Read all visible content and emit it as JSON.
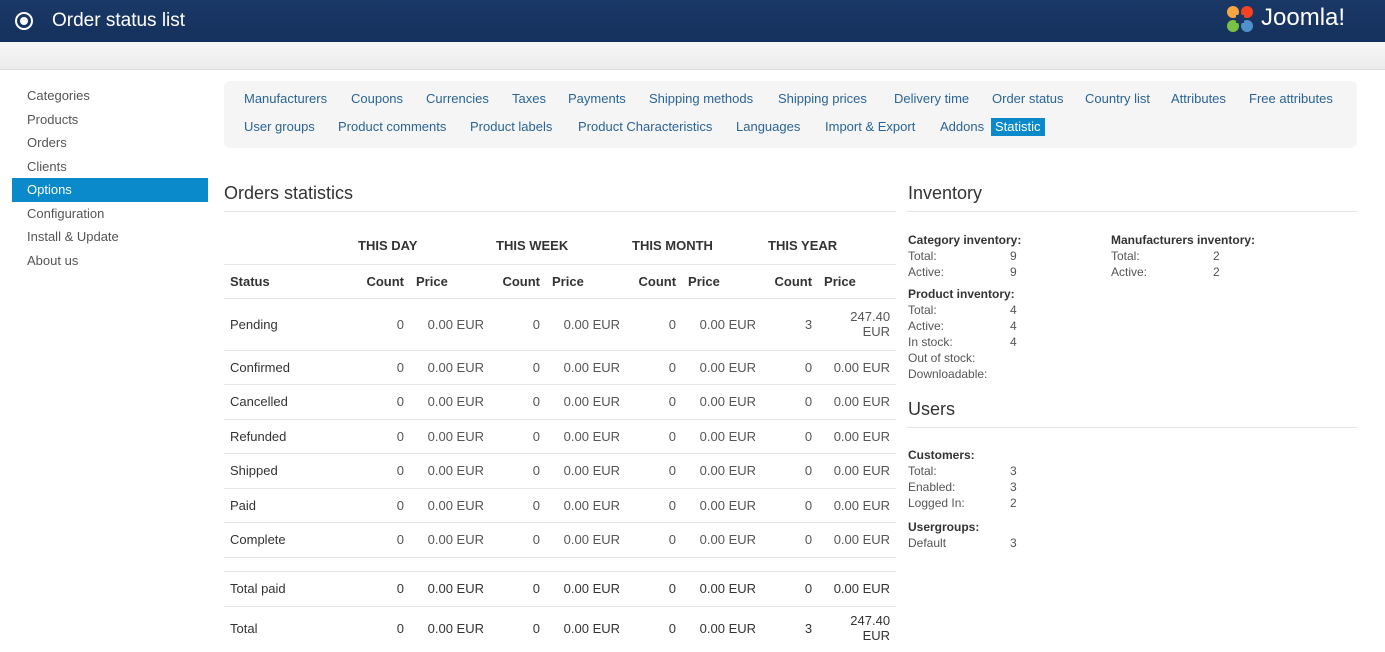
{
  "header": {
    "title": "Order status list",
    "brand": "Joomla!"
  },
  "sidebar": {
    "items": [
      {
        "label": "Categories",
        "active": false
      },
      {
        "label": "Products",
        "active": false
      },
      {
        "label": "Orders",
        "active": false
      },
      {
        "label": "Clients",
        "active": false
      },
      {
        "label": "Options",
        "active": true
      },
      {
        "label": "Configuration",
        "active": false
      },
      {
        "label": "Install & Update",
        "active": false
      },
      {
        "label": "About us",
        "active": false
      }
    ]
  },
  "submenu": {
    "row1": [
      "Manufacturers",
      "Coupons",
      "Currencies",
      "Taxes",
      "Payments",
      "Shipping methods",
      "Shipping prices",
      "Delivery time",
      "Order status",
      "Country list",
      "Attributes",
      "Free attributes"
    ],
    "row2": [
      "User groups",
      "Product comments",
      "Product labels",
      "Product Characteristics",
      "Languages",
      "Import & Export",
      "Addons",
      "Statistic"
    ],
    "active": "Statistic"
  },
  "orders": {
    "title": "Orders statistics",
    "periods": [
      "THIS DAY",
      "THIS WEEK",
      "THIS MONTH",
      "THIS YEAR"
    ],
    "status_header": "Status",
    "count_header": "Count",
    "price_header": "Price",
    "rows": [
      {
        "status": "Pending",
        "values": [
          "0",
          "0.00 EUR",
          "0",
          "0.00 EUR",
          "0",
          "0.00 EUR",
          "3",
          "247.40 EUR"
        ]
      },
      {
        "status": "Confirmed",
        "values": [
          "0",
          "0.00 EUR",
          "0",
          "0.00 EUR",
          "0",
          "0.00 EUR",
          "0",
          "0.00 EUR"
        ]
      },
      {
        "status": "Cancelled",
        "values": [
          "0",
          "0.00 EUR",
          "0",
          "0.00 EUR",
          "0",
          "0.00 EUR",
          "0",
          "0.00 EUR"
        ]
      },
      {
        "status": "Refunded",
        "values": [
          "0",
          "0.00 EUR",
          "0",
          "0.00 EUR",
          "0",
          "0.00 EUR",
          "0",
          "0.00 EUR"
        ]
      },
      {
        "status": "Shipped",
        "values": [
          "0",
          "0.00 EUR",
          "0",
          "0.00 EUR",
          "0",
          "0.00 EUR",
          "0",
          "0.00 EUR"
        ]
      },
      {
        "status": "Paid",
        "values": [
          "0",
          "0.00 EUR",
          "0",
          "0.00 EUR",
          "0",
          "0.00 EUR",
          "0",
          "0.00 EUR"
        ]
      },
      {
        "status": "Complete",
        "values": [
          "0",
          "0.00 EUR",
          "0",
          "0.00 EUR",
          "0",
          "0.00 EUR",
          "0",
          "0.00 EUR"
        ]
      }
    ],
    "totals": [
      {
        "status": "Total paid",
        "values": [
          "0",
          "0.00 EUR",
          "0",
          "0.00 EUR",
          "0",
          "0.00 EUR",
          "0",
          "0.00 EUR"
        ]
      },
      {
        "status": "Total",
        "values": [
          "0",
          "0.00 EUR",
          "0",
          "0.00 EUR",
          "0",
          "0.00 EUR",
          "3",
          "247.40 EUR"
        ]
      }
    ]
  },
  "inventory": {
    "title": "Inventory",
    "category": {
      "heading": "Category inventory:",
      "items": [
        {
          "label": "Total:",
          "value": "9"
        },
        {
          "label": "Active:",
          "value": "9"
        }
      ]
    },
    "manufacturers": {
      "heading": "Manufacturers inventory:",
      "items": [
        {
          "label": "Total:",
          "value": "2"
        },
        {
          "label": "Active:",
          "value": "2"
        }
      ]
    },
    "product": {
      "heading": "Product inventory:",
      "items": [
        {
          "label": "Total:",
          "value": "4"
        },
        {
          "label": "Active:",
          "value": "4"
        },
        {
          "label": "In stock:",
          "value": "4"
        },
        {
          "label": "Out of stock:",
          "value": ""
        },
        {
          "label": "Downloadable:",
          "value": ""
        }
      ]
    }
  },
  "users": {
    "title": "Users",
    "customers": {
      "heading": "Customers:",
      "items": [
        {
          "label": "Total:",
          "value": "3"
        },
        {
          "label": "Enabled:",
          "value": "3"
        },
        {
          "label": "Logged In:",
          "value": "2"
        }
      ]
    },
    "usergroups": {
      "heading": "Usergroups:",
      "items": [
        {
          "label": "Default",
          "value": "3"
        }
      ]
    }
  },
  "colors": {
    "header_bg": "#1a3867",
    "accent": "#0a8acb",
    "link": "#2a6496"
  }
}
